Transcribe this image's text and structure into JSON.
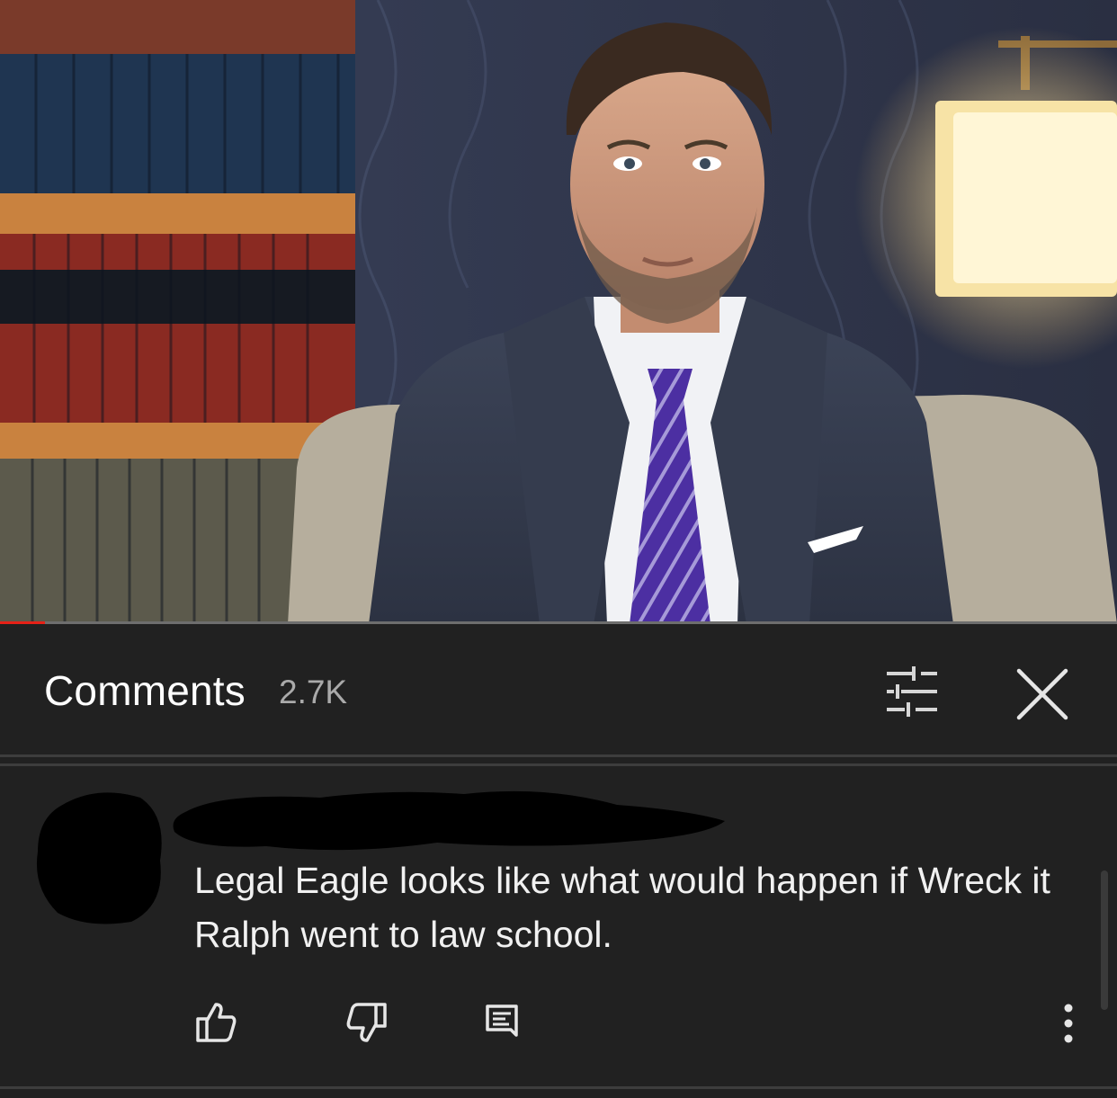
{
  "video": {
    "progress_fraction": 0.04
  },
  "comments_header": {
    "title": "Comments",
    "count": "2.7K",
    "filter_icon": "sort-sliders-icon",
    "close_icon": "close-icon"
  },
  "comment": {
    "avatar_redacted": true,
    "author_redacted": true,
    "text": "Legal Eagle looks like what would happen if Wreck it Ralph went to law school.",
    "actions": {
      "like_icon": "thumbs-up-icon",
      "dislike_icon": "thumbs-down-icon",
      "reply_icon": "reply-icon",
      "more_icon": "more-vert-icon"
    }
  },
  "colors": {
    "background": "#212121",
    "progress": "#e62117",
    "text": "#f1f1f1",
    "count": "#aaaaaa"
  }
}
